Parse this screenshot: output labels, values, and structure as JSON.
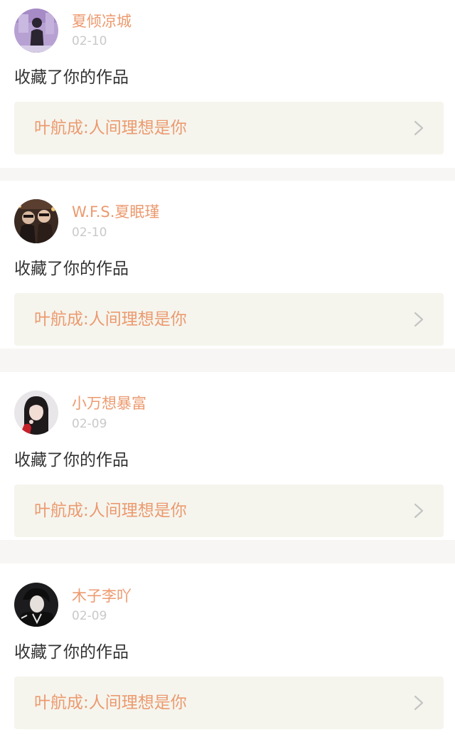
{
  "notifications": [
    {
      "username": "夏倾凉城",
      "date": "02-10",
      "action": "收藏了你的作品",
      "work_title": "叶航成:人间理想是你",
      "avatar": "avatar-girl-standing",
      "colors": {
        "bg": "#b49ad0",
        "fg": "#2a2530"
      }
    },
    {
      "username": "W.F.S.夏眠瑾",
      "date": "02-10",
      "action": "收藏了你的作品",
      "work_title": "叶航成:人间理想是你",
      "avatar": "avatar-group-photo",
      "colors": {
        "bg": "#3a2a22",
        "fg": "#d8b8a0"
      }
    },
    {
      "username": "小万想暴富",
      "date": "02-09",
      "action": "收藏了你的作品",
      "work_title": "叶航成:人间理想是你",
      "avatar": "avatar-girl-portrait",
      "colors": {
        "bg": "#e6e4e6",
        "fg": "#1e1a1c"
      }
    },
    {
      "username": "木子李吖",
      "date": "02-09",
      "action": "收藏了你的作品",
      "work_title": "叶航成:人间理想是你",
      "avatar": "avatar-boy-dark",
      "colors": {
        "bg": "#1c1c1e",
        "fg": "#e6e6e6"
      }
    }
  ],
  "theme": {
    "accent": "#ec9a6f",
    "date_gray": "#c9c9c9",
    "text": "#333333",
    "link_bg": "#f5f5ee",
    "separator": "#f7f6f4"
  },
  "icons": {
    "link_arrow": "chevron-right-icon"
  }
}
